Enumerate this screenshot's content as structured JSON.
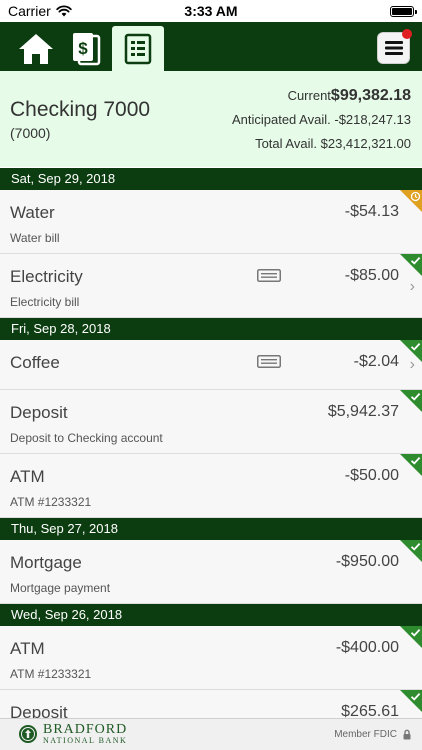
{
  "status_bar": {
    "carrier": "Carrier",
    "time": "3:33 AM"
  },
  "nav": {
    "active_tab": "register"
  },
  "account": {
    "name": "Checking 7000",
    "number": "(7000)",
    "current_label": "Current",
    "current_value": "$99,382.18",
    "anticipated_label": "Anticipated Avail.",
    "anticipated_value": "-$218,247.13",
    "total_label": "Total Avail.",
    "total_value": "$23,412,321.00"
  },
  "groups": [
    {
      "date": "Sat, Sep 29, 2018",
      "transactions": [
        {
          "name": "Water",
          "desc": "Water bill",
          "amount": "-$54.13",
          "status": "pending"
        },
        {
          "name": "Electricity",
          "desc": "Electricity bill",
          "amount": "-$85.00",
          "status": "cleared"
        }
      ]
    },
    {
      "date": "Fri, Sep 28, 2018",
      "transactions": [
        {
          "name": "Coffee",
          "desc": "",
          "amount": "-$2.04",
          "status": "cleared"
        },
        {
          "name": "Deposit",
          "desc": "Deposit to Checking account",
          "amount": "$5,942.37",
          "status": "cleared"
        },
        {
          "name": "ATM",
          "desc": "ATM #1233321",
          "amount": "-$50.00",
          "status": "cleared"
        }
      ]
    },
    {
      "date": "Thu, Sep 27, 2018",
      "transactions": [
        {
          "name": "Mortgage",
          "desc": "Mortgage payment",
          "amount": "-$950.00",
          "status": "cleared"
        }
      ]
    },
    {
      "date": "Wed, Sep 26, 2018",
      "transactions": [
        {
          "name": "ATM",
          "desc": "ATM #1233321",
          "amount": "-$400.00",
          "status": "cleared"
        },
        {
          "name": "Deposit",
          "desc": "",
          "amount": "$265.61",
          "status": "cleared"
        }
      ]
    }
  ],
  "footer": {
    "bank_line1": "BRADFORD",
    "bank_line2": "NATIONAL BANK",
    "fdic": "Member FDIC"
  },
  "colors": {
    "nav_green": "#0c3d10",
    "header_mint": "#e6fbe8",
    "cleared_green": "#2e8b2e",
    "pending_orange": "#e0a020",
    "notification_red": "#e02020"
  }
}
